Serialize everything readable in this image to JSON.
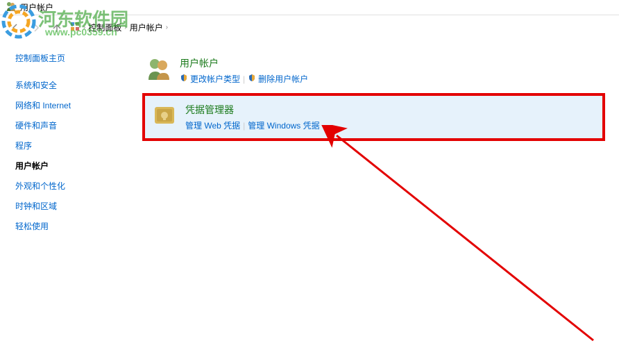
{
  "window": {
    "title": "用户帐户"
  },
  "watermark": {
    "text": "河东软件园",
    "url": "www.pc0359.cn"
  },
  "breadcrumb": {
    "items": [
      "控制面板",
      "用户帐户"
    ]
  },
  "sidebar": {
    "home": "控制面板主页",
    "items": [
      {
        "label": "系统和安全",
        "active": false
      },
      {
        "label": "网络和 Internet",
        "active": false
      },
      {
        "label": "硬件和声音",
        "active": false
      },
      {
        "label": "程序",
        "active": false
      },
      {
        "label": "用户帐户",
        "active": true
      },
      {
        "label": "外观和个性化",
        "active": false
      },
      {
        "label": "时钟和区域",
        "active": false
      },
      {
        "label": "轻松使用",
        "active": false
      }
    ]
  },
  "main": {
    "categories": [
      {
        "title": "用户帐户",
        "links": [
          {
            "text": "更改帐户类型",
            "shield": true
          },
          {
            "text": "删除用户帐户",
            "shield": true
          }
        ]
      },
      {
        "title": "凭据管理器",
        "highlighted": true,
        "links": [
          {
            "text": "管理 Web 凭据",
            "shield": false
          },
          {
            "text": "管理 Windows 凭据",
            "shield": false
          }
        ]
      }
    ]
  }
}
